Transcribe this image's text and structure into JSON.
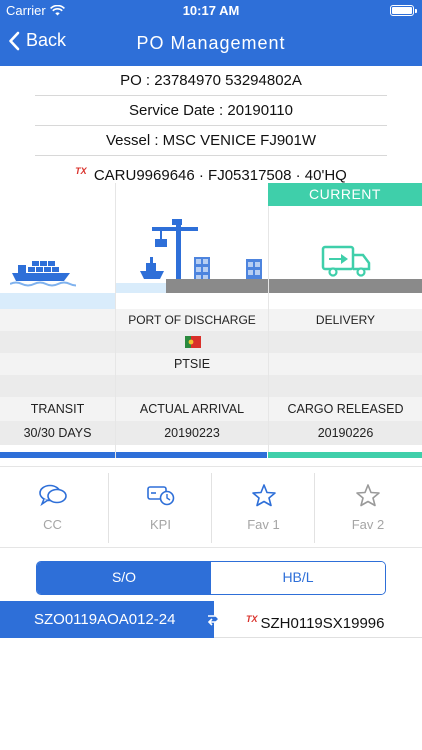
{
  "status_bar": {
    "carrier": "Carrier",
    "time": "10:17 AM"
  },
  "header": {
    "back_label": "Back",
    "title": "PO Management"
  },
  "info": {
    "po": "PO : 23784970    53294802A",
    "service_date": "Service Date : 20190110",
    "vessel": "Vessel : MSC VENICE FJ901W",
    "container_badge": "TX",
    "container": "CARU9969646 · FJ05317508 · 40'HQ"
  },
  "stages": {
    "current_label": "CURRENT",
    "columns": [
      {
        "heading": "",
        "code": "",
        "event": "TRANSIT",
        "value": "30/30 DAYS"
      },
      {
        "heading": "PORT OF DISCHARGE",
        "code": "PTSIE",
        "event": "ACTUAL ARRIVAL",
        "value": "20190223"
      },
      {
        "heading": "DELIVERY",
        "code": "",
        "event": "CARGO RELEASED",
        "value": "20190226"
      }
    ]
  },
  "actions": [
    {
      "label": "CC",
      "icon": "chat-bubbles-icon"
    },
    {
      "label": "KPI",
      "icon": "kpi-clock-icon"
    },
    {
      "label": "Fav 1",
      "icon": "star-icon"
    },
    {
      "label": "Fav 2",
      "icon": "star-icon"
    }
  ],
  "segments": {
    "left": "S/O",
    "right": "HB/L"
  },
  "refs": {
    "so_number": "SZO0119AOA012-24",
    "hbl_badge": "TX",
    "hbl_number": "SZH0119SX19996"
  },
  "colors": {
    "primary": "#2e6fd8",
    "current": "#3fcfaa",
    "flag_green": "#2b8a3e",
    "flag_red": "#d9302a"
  }
}
